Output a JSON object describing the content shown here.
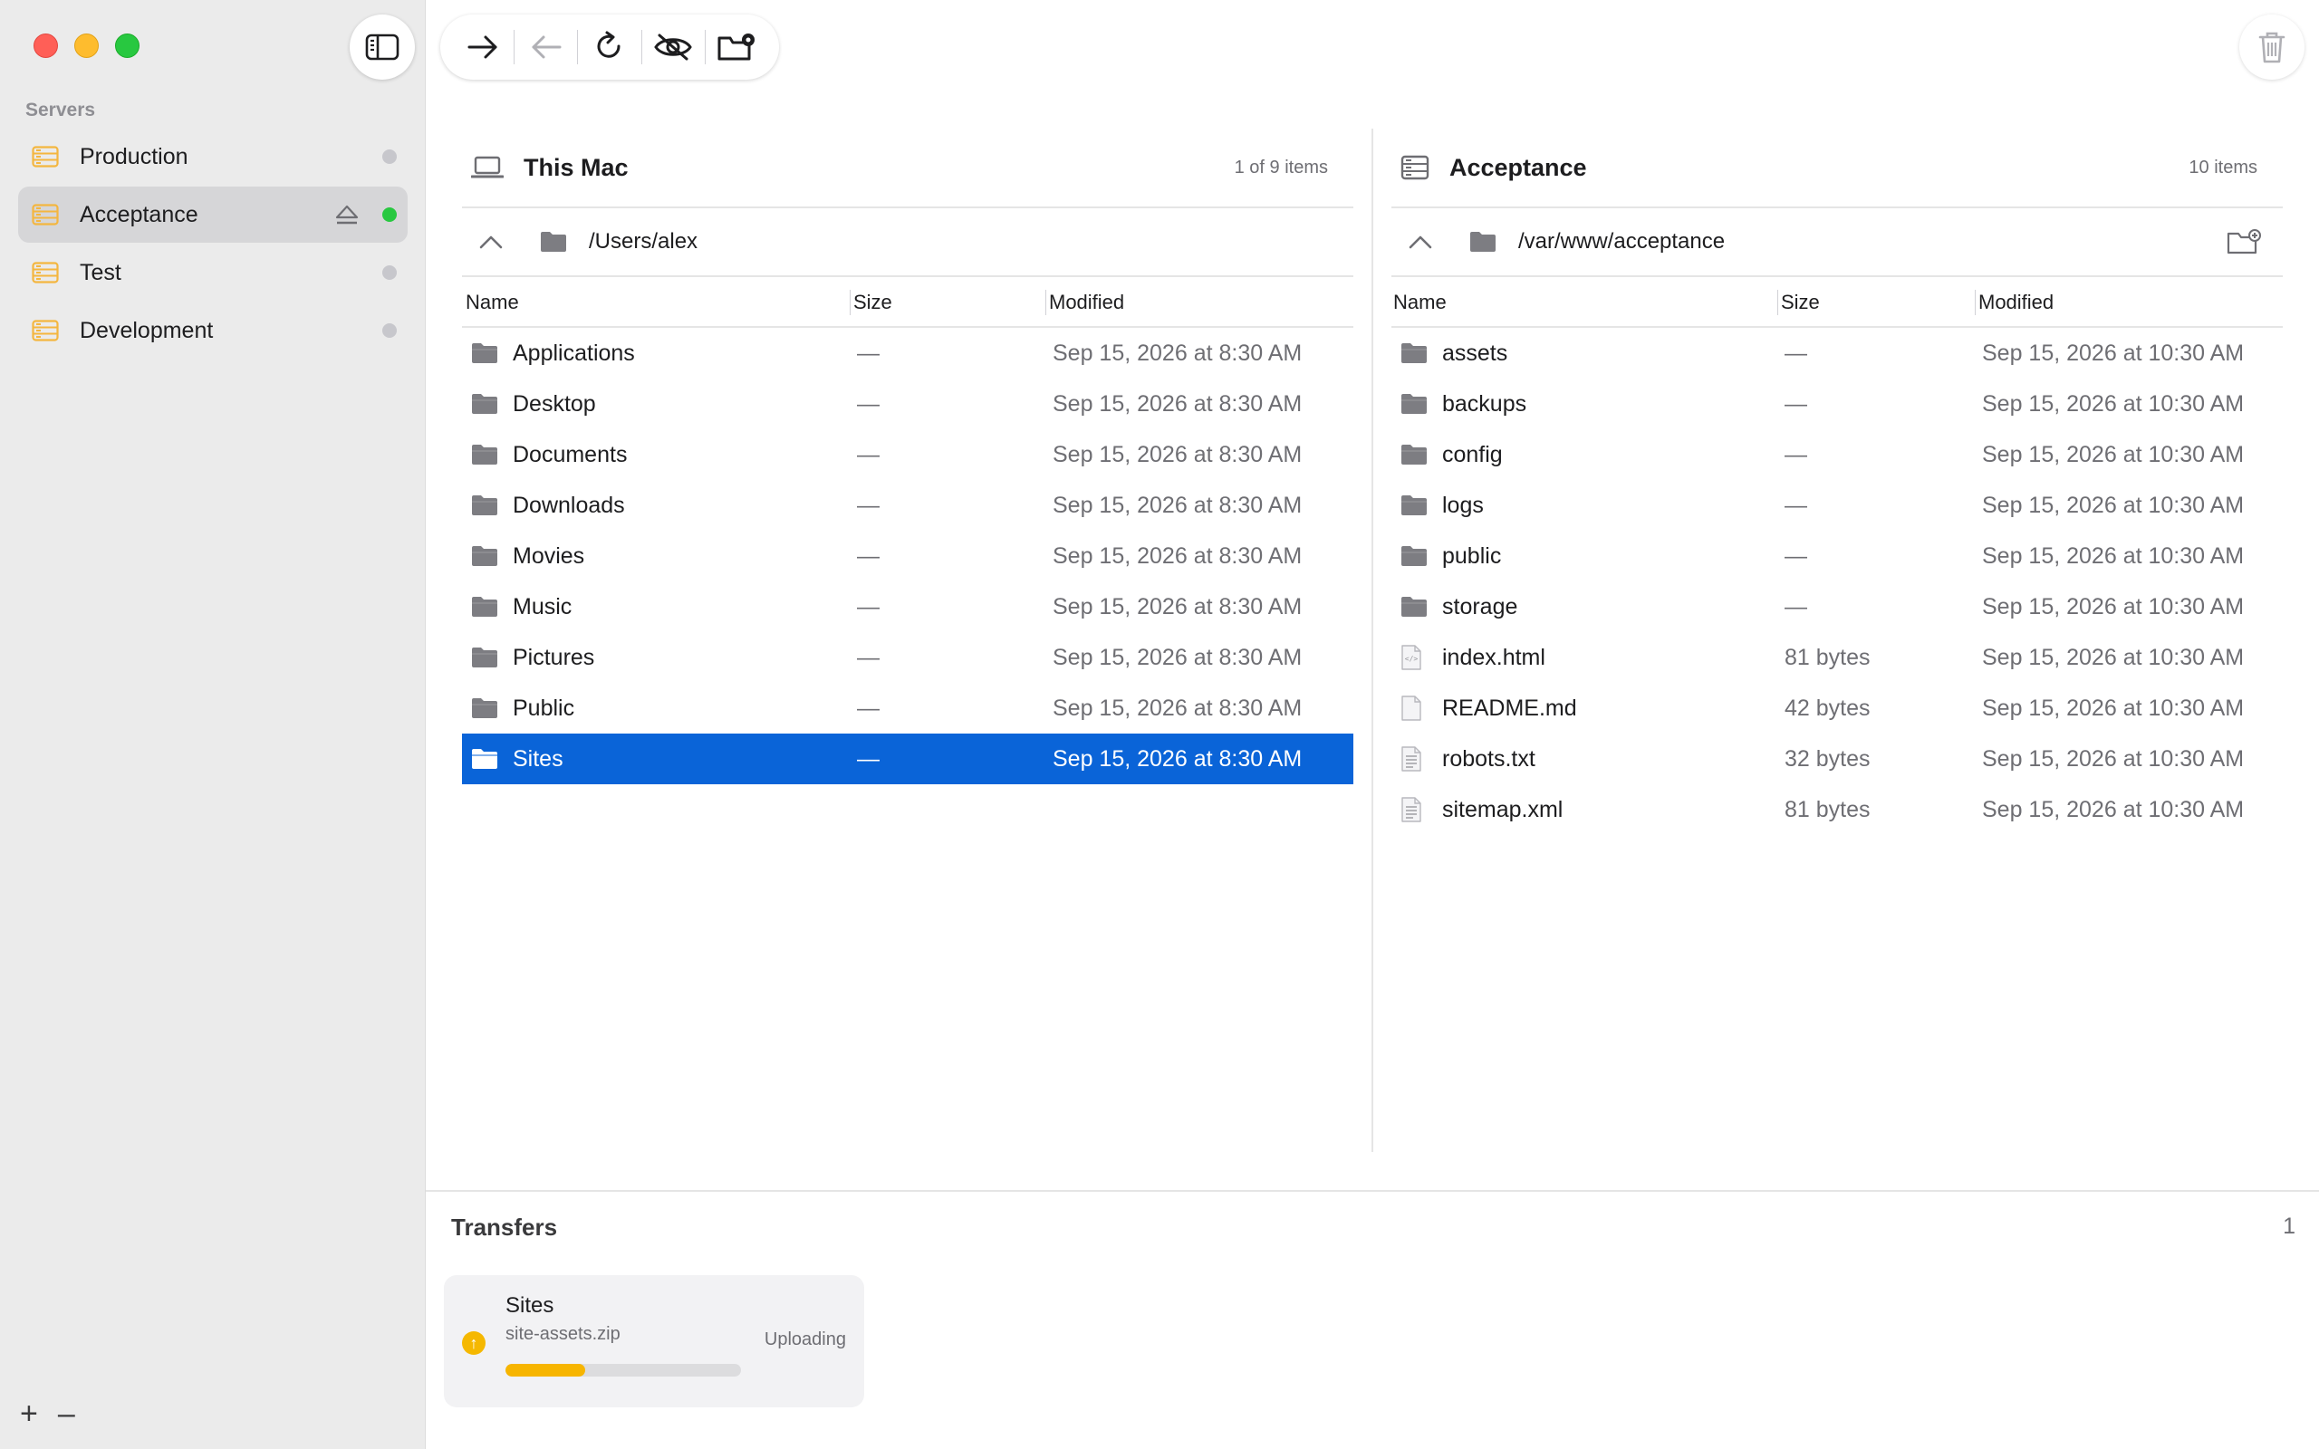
{
  "sidebar": {
    "servers_heading": "Servers",
    "servers": [
      {
        "label": "Production",
        "selected": false,
        "connected": false
      },
      {
        "label": "Acceptance",
        "selected": true,
        "connected": true
      },
      {
        "label": "Test",
        "selected": false,
        "connected": false
      },
      {
        "label": "Development",
        "selected": false,
        "connected": false
      }
    ],
    "add_label": "+",
    "remove_label": "–"
  },
  "colors": {
    "selection": "#0a64d8",
    "server_icon": "#f4b63f",
    "online": "#28c840",
    "progress": "#f7b500"
  },
  "left_pane": {
    "title": "This Mac",
    "count": "1 of 9 items",
    "path": "/Users/alex",
    "columns": {
      "name": "Name",
      "size": "Size",
      "modified": "Modified"
    },
    "rows": [
      {
        "name": "Applications",
        "size": "—",
        "modified": "Sep 15, 2026 at 8:30 AM",
        "type": "folder",
        "selected": false
      },
      {
        "name": "Desktop",
        "size": "—",
        "modified": "Sep 15, 2026 at 8:30 AM",
        "type": "folder",
        "selected": false
      },
      {
        "name": "Documents",
        "size": "—",
        "modified": "Sep 15, 2026 at 8:30 AM",
        "type": "folder",
        "selected": false
      },
      {
        "name": "Downloads",
        "size": "—",
        "modified": "Sep 15, 2026 at 8:30 AM",
        "type": "folder",
        "selected": false
      },
      {
        "name": "Movies",
        "size": "—",
        "modified": "Sep 15, 2026 at 8:30 AM",
        "type": "folder",
        "selected": false
      },
      {
        "name": "Music",
        "size": "—",
        "modified": "Sep 15, 2026 at 8:30 AM",
        "type": "folder",
        "selected": false
      },
      {
        "name": "Pictures",
        "size": "—",
        "modified": "Sep 15, 2026 at 8:30 AM",
        "type": "folder",
        "selected": false
      },
      {
        "name": "Public",
        "size": "—",
        "modified": "Sep 15, 2026 at 8:30 AM",
        "type": "folder",
        "selected": false
      },
      {
        "name": "Sites",
        "size": "—",
        "modified": "Sep 15, 2026 at 8:30 AM",
        "type": "folder",
        "selected": true
      }
    ]
  },
  "right_pane": {
    "title": "Acceptance",
    "count": "10 items",
    "path": "/var/www/acceptance",
    "columns": {
      "name": "Name",
      "size": "Size",
      "modified": "Modified"
    },
    "rows": [
      {
        "name": "assets",
        "size": "—",
        "modified": "Sep 15, 2026 at 10:30 AM",
        "type": "folder"
      },
      {
        "name": "backups",
        "size": "—",
        "modified": "Sep 15, 2026 at 10:30 AM",
        "type": "folder"
      },
      {
        "name": "config",
        "size": "—",
        "modified": "Sep 15, 2026 at 10:30 AM",
        "type": "folder"
      },
      {
        "name": "logs",
        "size": "—",
        "modified": "Sep 15, 2026 at 10:30 AM",
        "type": "folder"
      },
      {
        "name": "public",
        "size": "—",
        "modified": "Sep 15, 2026 at 10:30 AM",
        "type": "folder"
      },
      {
        "name": "storage",
        "size": "—",
        "modified": "Sep 15, 2026 at 10:30 AM",
        "type": "folder"
      },
      {
        "name": "index.html",
        "size": "81 bytes",
        "modified": "Sep 15, 2026 at 10:30 AM",
        "type": "html"
      },
      {
        "name": "README.md",
        "size": "42 bytes",
        "modified": "Sep 15, 2026 at 10:30 AM",
        "type": "file"
      },
      {
        "name": "robots.txt",
        "size": "32 bytes",
        "modified": "Sep 15, 2026 at 10:30 AM",
        "type": "text"
      },
      {
        "name": "sitemap.xml",
        "size": "81 bytes",
        "modified": "Sep 15, 2026 at 10:30 AM",
        "type": "text"
      }
    ]
  },
  "transfers": {
    "title": "Transfers",
    "count": "1",
    "items": [
      {
        "name": "Sites",
        "file": "site-assets.zip",
        "status": "Uploading",
        "progress": 0.34
      }
    ]
  }
}
